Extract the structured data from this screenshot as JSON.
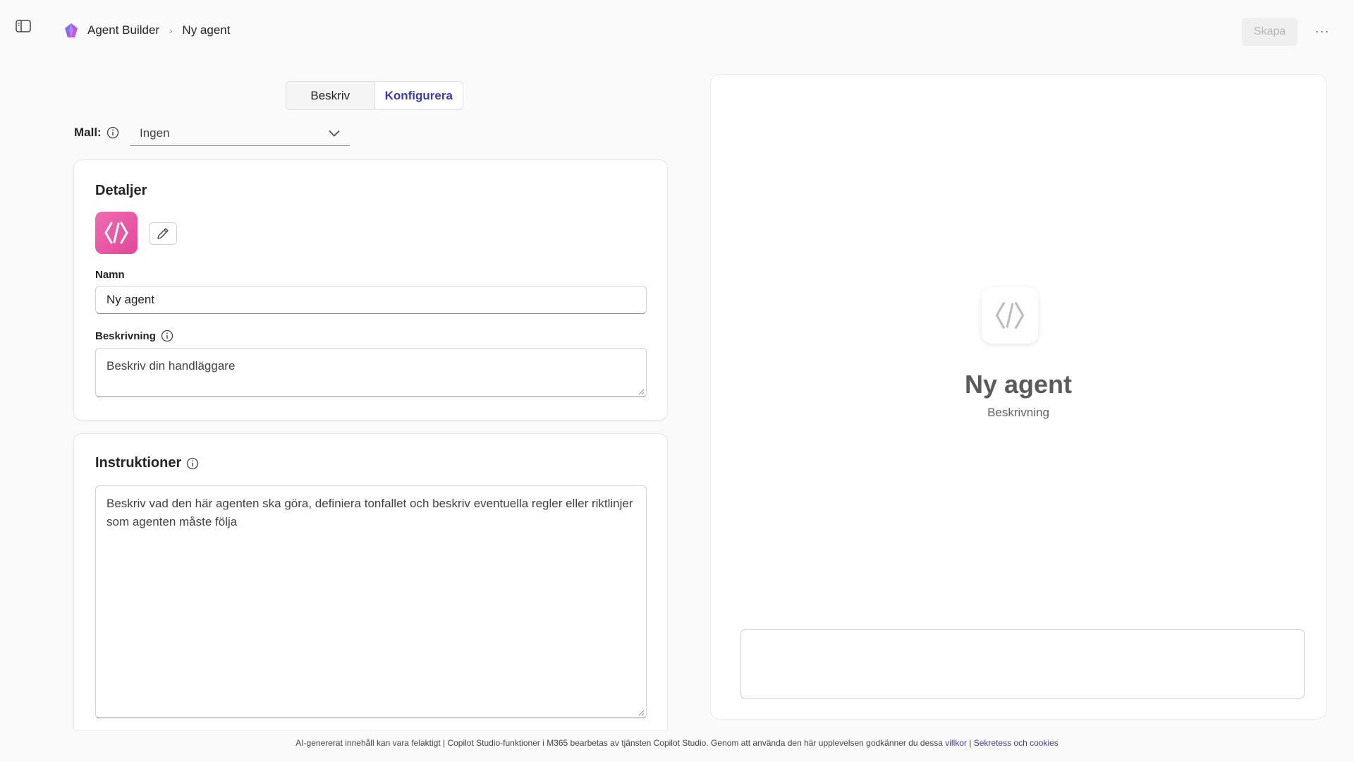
{
  "header": {
    "breadcrumb": {
      "app": "Agent Builder",
      "current": "Ny agent"
    },
    "create_label": "Skapa",
    "more_label": "···"
  },
  "tabs": [
    {
      "label": "Beskriv",
      "active": false
    },
    {
      "label": "Konfigurera",
      "active": true
    }
  ],
  "template": {
    "label": "Mall:",
    "value": "Ingen"
  },
  "details": {
    "title": "Detaljer",
    "name_label": "Namn",
    "name_value": "Ny agent",
    "description_label": "Beskrivning",
    "description_placeholder": "Beskriv din handläggare"
  },
  "instructions": {
    "title": "Instruktioner",
    "placeholder": "Beskriv vad den här agenten ska göra, definiera tonfallet och beskriv eventuella regler eller riktlinjer som agenten måste följa"
  },
  "preview": {
    "name": "Ny agent",
    "description": "Beskrivning"
  },
  "footer": {
    "text": "AI-genererat innehåll kan vara felaktigt | Copilot Studio-funktioner i M365 bearbetas av tjänsten Copilot Studio. Genom att använda den här upplevelsen godkänner du dessa ",
    "terms_link": "villkor",
    "separator": " | ",
    "privacy_link": "Sekretess och cookies"
  },
  "colors": {
    "accent": "#3a3ab3",
    "agent_icon": "#e2479a"
  },
  "icons": {
    "sidebar_toggle": "panel-left-icon",
    "app_logo": "copilot-logo-icon",
    "chevron": "chevron-right-icon",
    "info": "info-icon",
    "dropdown": "chevron-down-icon",
    "agent": "code-brackets-icon",
    "edit": "pencil-icon"
  }
}
